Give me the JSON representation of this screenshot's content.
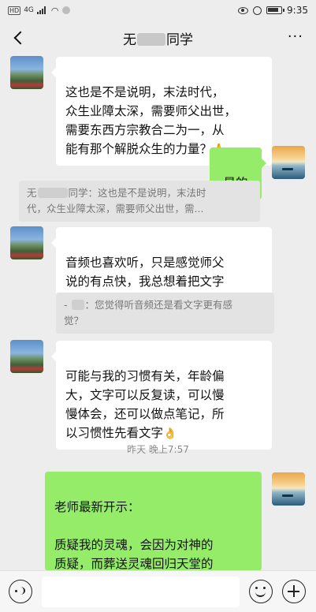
{
  "status_bar": {
    "network_badge": "HD",
    "network_type": "4G",
    "time": "9:35"
  },
  "header": {
    "title_prefix": "无",
    "title_suffix": "同学",
    "more_label": "···"
  },
  "messages": [
    {
      "sender": "student",
      "text": "这也是不是说明，末法时代，\n众生业障太深，需要师父出世，\n需要东西方宗教合二为一，从\n能有那个解脱众生的力量？",
      "emoji": "🙏"
    },
    {
      "sender": "teacher",
      "text": "是的"
    },
    {
      "sender": "quote",
      "prefix": "无",
      "line1": "同学：这也是不是说明，末法时",
      "line2": "代，众生业障太深，需要师父出世，需..."
    },
    {
      "sender": "student",
      "text": "音频也喜欢听，只是感觉师父\n说的有点快，我总想着把文字\n读完，所以还没有听多少",
      "emoji": "😁🙏"
    },
    {
      "sender": "quote",
      "prefix": "-",
      "line1": "：您觉得听音频还是看文字更有感",
      "line2": "觉？"
    },
    {
      "sender": "student",
      "text": "可能与我的习惯有关，年龄偏\n大，文字可以反复读，可以慢\n慢体会，还可以做点笔记，所\n以习惯性先看文字",
      "emoji": "👌"
    },
    {
      "sender": "teacher",
      "text": "老师最新开示：\n\n质疑我的灵魂，会因为对神的\n质疑，而葬送灵魂回归天堂的\n道路，这是必定的结局，无可\n改变。我是上司的修行者，下"
    }
  ],
  "timestamp": "昨天 晚上7:57",
  "footer": {
    "voice_icon": "voice-icon",
    "emoji_icon": "emoji-icon",
    "plus_icon": "plus-icon"
  }
}
